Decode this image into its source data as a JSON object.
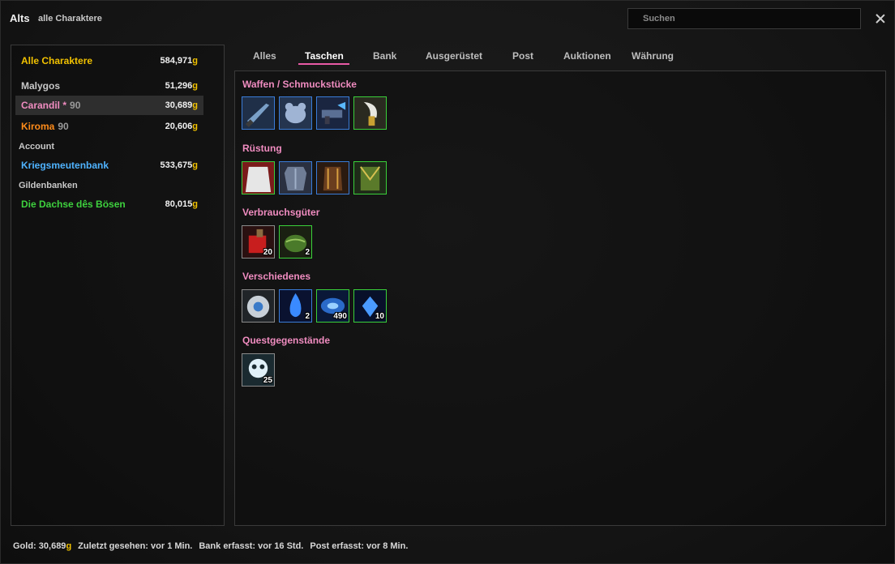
{
  "header": {
    "title": "Alts",
    "subtitle": "alle Charaktere",
    "search_placeholder": "Suchen"
  },
  "sidebar": {
    "characters": [
      {
        "name": "Alle Charaktere",
        "level": "",
        "gold": "584,971",
        "color": "#f2c200"
      },
      {
        "name": "Malygos",
        "level": "",
        "gold": "51,296",
        "color": "#c8c8c8"
      },
      {
        "name": "Carandil *",
        "level": "90",
        "gold": "30,689",
        "color": "#f08cc0"
      },
      {
        "name": "Kiroma",
        "level": "90",
        "gold": "20,606",
        "color": "#ff8c1a"
      }
    ],
    "account_label": "Account",
    "account_bank": {
      "name": "Kriegsmeutenbank",
      "gold": "533,675",
      "color": "#4fb3ff"
    },
    "guild_label": "Gildenbanken",
    "guild_bank": {
      "name": "Die Dachse dês Bösen",
      "gold": "80,015",
      "color": "#3ed13e"
    },
    "gold_suffix": "g"
  },
  "tabs": [
    "Alles",
    "Taschen",
    "Bank",
    "Ausgerüstet",
    "Post",
    "Auktionen",
    "Währung"
  ],
  "active_tab": "Taschen",
  "categories": [
    {
      "title": "Waffen / Schmuckstücke",
      "items": [
        {
          "icon": "dagger-icon",
          "quality": "blue",
          "count": ""
        },
        {
          "icon": "bear-figurine-icon",
          "quality": "blue",
          "count": ""
        },
        {
          "icon": "blaster-icon",
          "quality": "blue",
          "count": ""
        },
        {
          "icon": "fang-knife-icon",
          "quality": "green",
          "count": ""
        }
      ]
    },
    {
      "title": "Rüstung",
      "items": [
        {
          "icon": "cloak-icon",
          "quality": "green",
          "count": ""
        },
        {
          "icon": "chest-armor-icon",
          "quality": "blue",
          "count": ""
        },
        {
          "icon": "leather-vest-icon",
          "quality": "blue",
          "count": ""
        },
        {
          "icon": "green-tabard-icon",
          "quality": "green",
          "count": ""
        }
      ]
    },
    {
      "title": "Verbrauchsgüter",
      "items": [
        {
          "icon": "red-potion-icon",
          "quality": "gray",
          "count": "20"
        },
        {
          "icon": "green-food-icon",
          "quality": "green",
          "count": "2"
        }
      ]
    },
    {
      "title": "Verschiedenes",
      "items": [
        {
          "icon": "disc-icon",
          "quality": "gray",
          "count": ""
        },
        {
          "icon": "blue-flame-icon",
          "quality": "blue",
          "count": "2"
        },
        {
          "icon": "blue-orb-icon",
          "quality": "green",
          "count": "490"
        },
        {
          "icon": "blue-crystal-icon",
          "quality": "green",
          "count": "10"
        }
      ]
    },
    {
      "title": "Questgegenstände",
      "items": [
        {
          "icon": "spirit-icon",
          "quality": "gray",
          "count": "25"
        }
      ]
    }
  ],
  "footer": {
    "gold_label": "Gold:",
    "gold_value": "30,689",
    "gold_suffix": "g",
    "last_seen": "Zuletzt gesehen: vor 1 Min.",
    "bank_captured": "Bank erfasst: vor 16 Std.",
    "mail_captured": "Post erfasst: vor 8 Min."
  }
}
